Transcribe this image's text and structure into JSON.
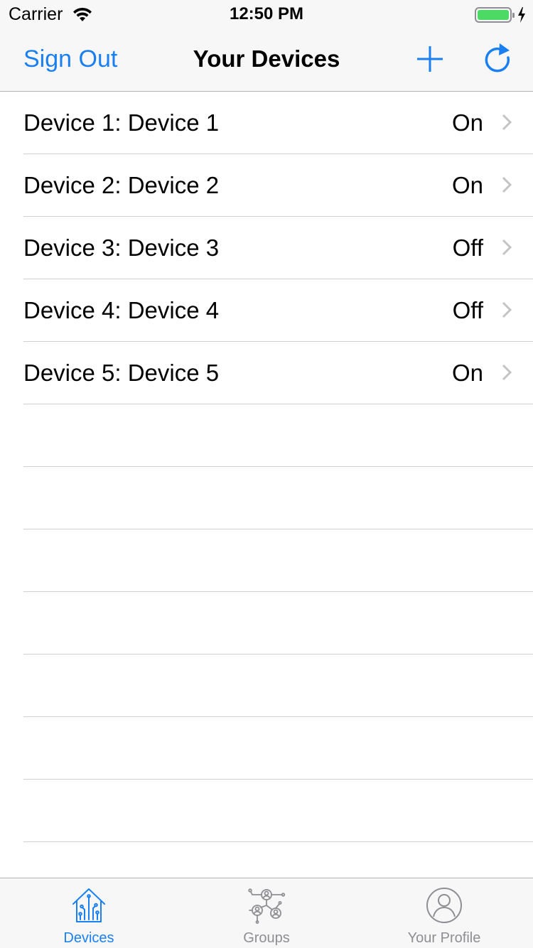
{
  "status_bar": {
    "carrier": "Carrier",
    "time": "12:50 PM",
    "battery_color": "#4cd964"
  },
  "nav": {
    "left_button": "Sign Out",
    "title": "Your Devices",
    "accent_color": "#1a7ff0"
  },
  "devices": [
    {
      "name": "Device 1: Device 1",
      "status": "On"
    },
    {
      "name": "Device 2: Device 2",
      "status": "On"
    },
    {
      "name": "Device 3: Device 3",
      "status": "Off"
    },
    {
      "name": "Device 4: Device 4",
      "status": "Off"
    },
    {
      "name": "Device 5: Device 5",
      "status": "On"
    }
  ],
  "tabs": [
    {
      "label": "Devices",
      "icon": "house-circuit-icon",
      "selected": true
    },
    {
      "label": "Groups",
      "icon": "groups-network-icon",
      "selected": false
    },
    {
      "label": "Your Profile",
      "icon": "profile-icon",
      "selected": false
    }
  ]
}
